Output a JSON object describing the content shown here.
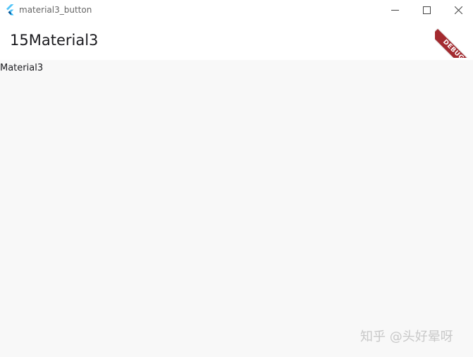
{
  "window": {
    "title": "material3_button",
    "controls": {
      "minimize_icon": "minimize-icon",
      "maximize_icon": "maximize-icon",
      "close_icon": "close-icon"
    }
  },
  "app_bar": {
    "title": "15Material3"
  },
  "content": {
    "text": "Material3"
  },
  "debug_banner": {
    "label": "DEBUG",
    "color": "#a32a2f"
  },
  "watermark": {
    "text": "知乎 @头好晕呀"
  },
  "colors": {
    "background": "#f8f8f8",
    "app_bar": "#ffffff",
    "flutter_logo_light": "#54c5f8",
    "flutter_logo_dark": "#01579b"
  }
}
